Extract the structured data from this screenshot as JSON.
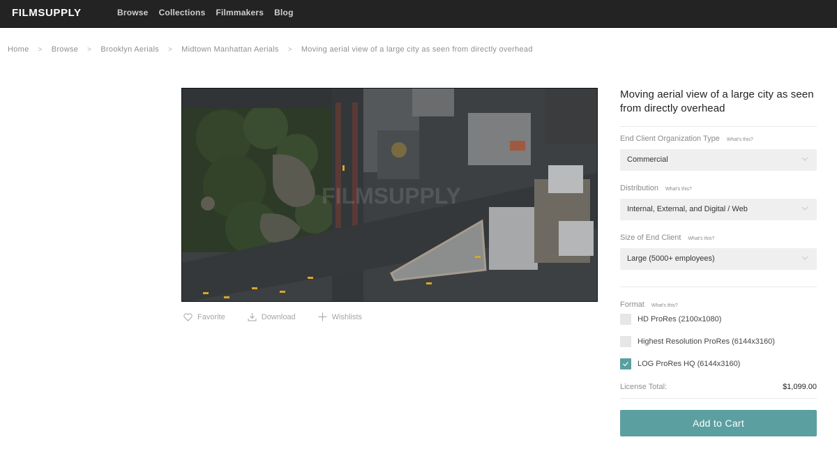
{
  "header": {
    "logo": "FILMSUPPLY",
    "nav": [
      "Browse",
      "Collections",
      "Filmmakers",
      "Blog"
    ]
  },
  "breadcrumb": {
    "separator": ">",
    "items": [
      "Home",
      "Browse",
      "Brooklyn Aerials",
      "Midtown Manhattan Aerials",
      "Moving aerial view of a large city as seen from directly overhead"
    ]
  },
  "video": {
    "watermark": "FILMSUPPLY",
    "description": "Aerial overhead view of Madison Square Park and the Flatiron Building area in Manhattan"
  },
  "actions": {
    "favorite": "Favorite",
    "download": "Download",
    "wishlists": "Wishlists"
  },
  "panel": {
    "title": "Moving aerial view of a large city as seen from directly overhead",
    "whats_this": "What's this?",
    "fields": [
      {
        "label": "End Client Organization Type",
        "value": "Commercial"
      },
      {
        "label": "Distribution",
        "value": "Internal, External, and Digital / Web"
      },
      {
        "label": "Size of End Client",
        "value": "Large (5000+ employees)"
      }
    ],
    "format": {
      "label": "Format",
      "options": [
        {
          "label": "HD ProRes (2100x1080)",
          "checked": false
        },
        {
          "label": "Highest Resolution ProRes (6144x3160)",
          "checked": false
        },
        {
          "label": "LOG ProRes HQ (6144x3160)",
          "checked": true
        }
      ]
    },
    "license_total_label": "License Total:",
    "license_total_value": "$1,099.00",
    "add_to_cart": "Add to Cart"
  },
  "colors": {
    "accent": "#5b9fa1",
    "header_bg": "#232323",
    "field_bg": "#efefef"
  }
}
